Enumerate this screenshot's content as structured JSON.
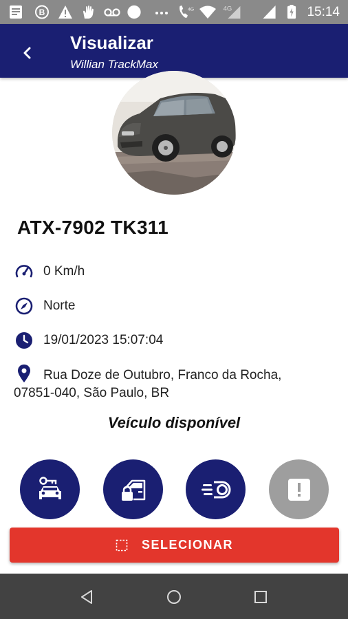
{
  "status_bar": {
    "time": "15:14",
    "network_label_1": "4G",
    "network_label_2": "4G"
  },
  "app_bar": {
    "title": "Visualizar",
    "subtitle": "Willian TrackMax"
  },
  "vehicle": {
    "plate": "ATX-7902 TK311",
    "speed": "0 Km/h",
    "direction": "Norte",
    "timestamp": "19/01/2023 15:07:04",
    "address": "Rua Doze de Outubro, Franco da Rocha, 07851-040, São Paulo, BR",
    "status": "Veículo disponível"
  },
  "actions": {
    "select_label": "SELECIONAR"
  },
  "colors": {
    "primary": "#1a1f72",
    "accent": "#e3362c",
    "disabled": "#9e9e9e"
  }
}
